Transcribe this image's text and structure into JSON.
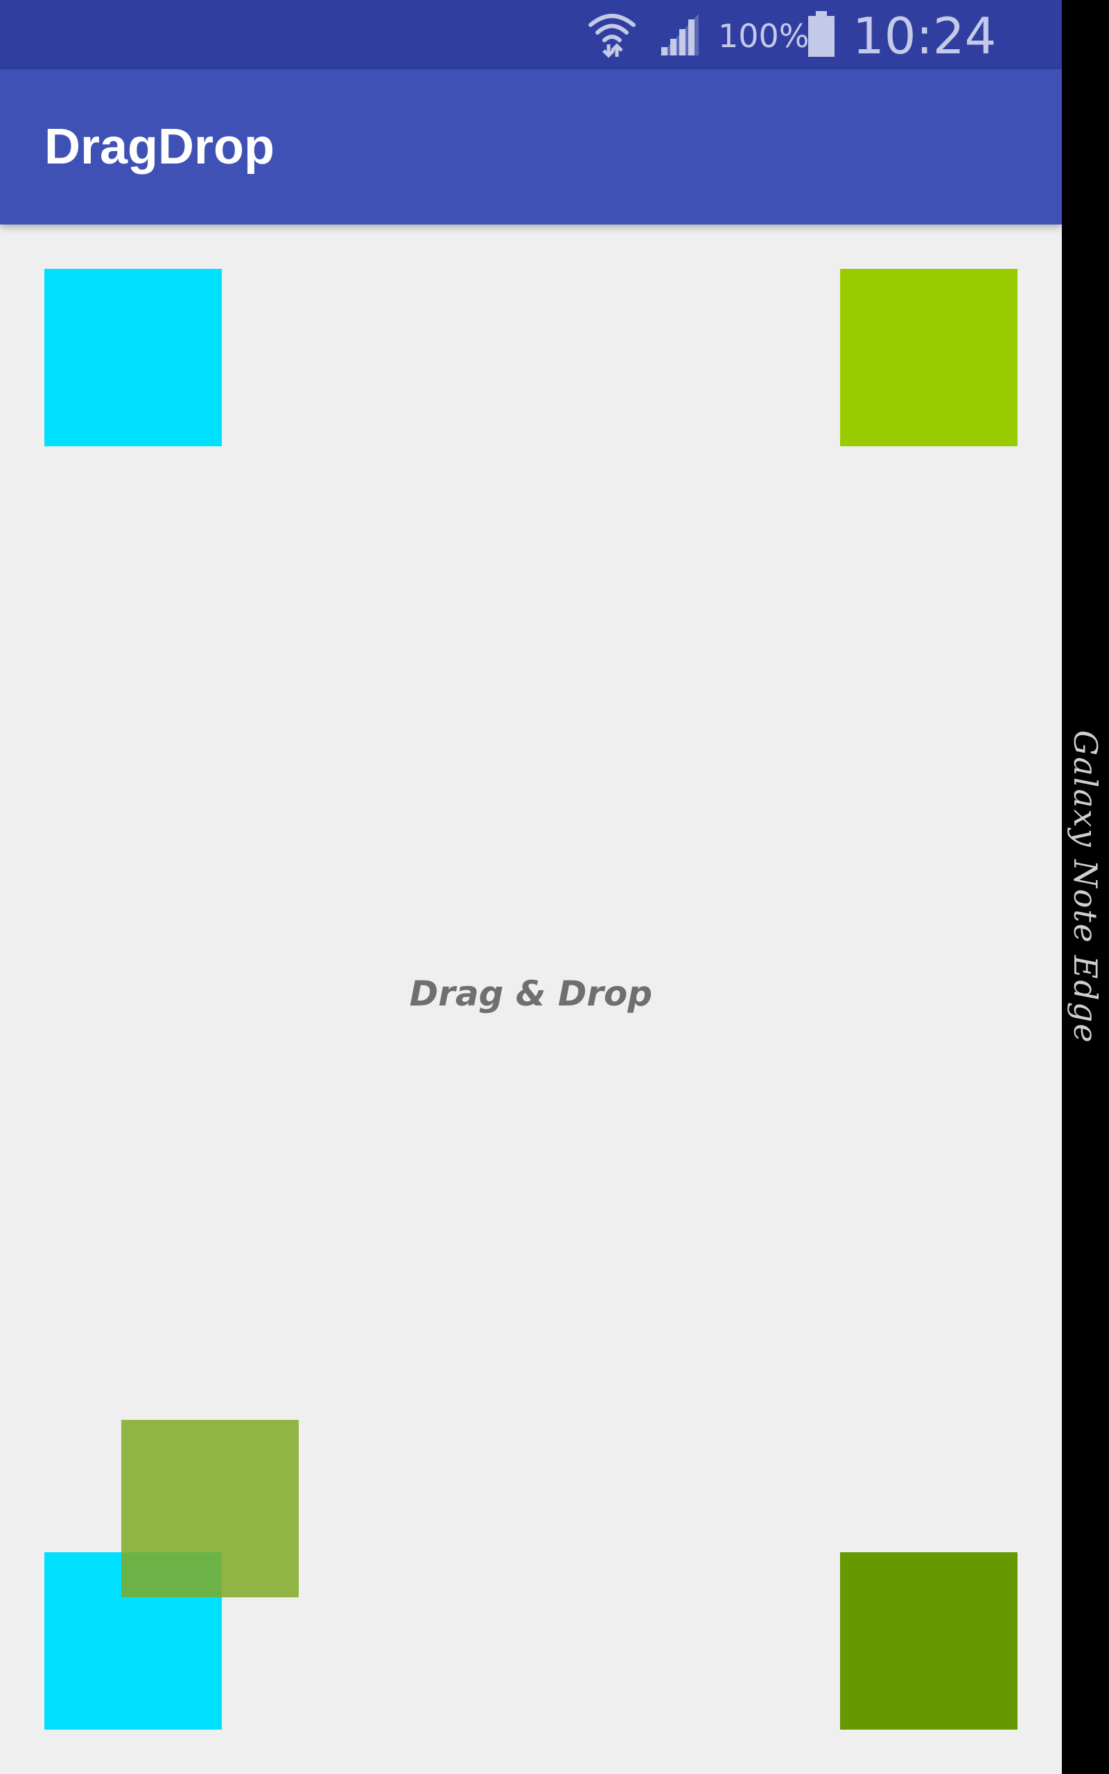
{
  "status_bar": {
    "battery_percent": "100%",
    "time": "10:24",
    "icons": [
      "wifi-icon",
      "cellular-signal-icon",
      "battery-icon"
    ]
  },
  "app_bar": {
    "title": "DragDrop"
  },
  "content": {
    "label": "Drag & Drop",
    "squares": [
      {
        "name": "square-top-left",
        "color": "#00e0ff"
      },
      {
        "name": "square-top-right",
        "color": "#99cc00"
      },
      {
        "name": "square-dragging",
        "color": "#7faa27",
        "opacity": 0.85
      },
      {
        "name": "square-bottom-left",
        "color": "#00e0ff"
      },
      {
        "name": "square-bottom-right",
        "color": "#669900"
      }
    ]
  },
  "edge_panel": {
    "label": "Galaxy Note Edge"
  },
  "colors": {
    "status_bar": "#303f9f",
    "app_bar": "#3f51b5",
    "background": "#efefef",
    "status_text": "#c5cae9",
    "label_text": "#6f6f6f"
  }
}
